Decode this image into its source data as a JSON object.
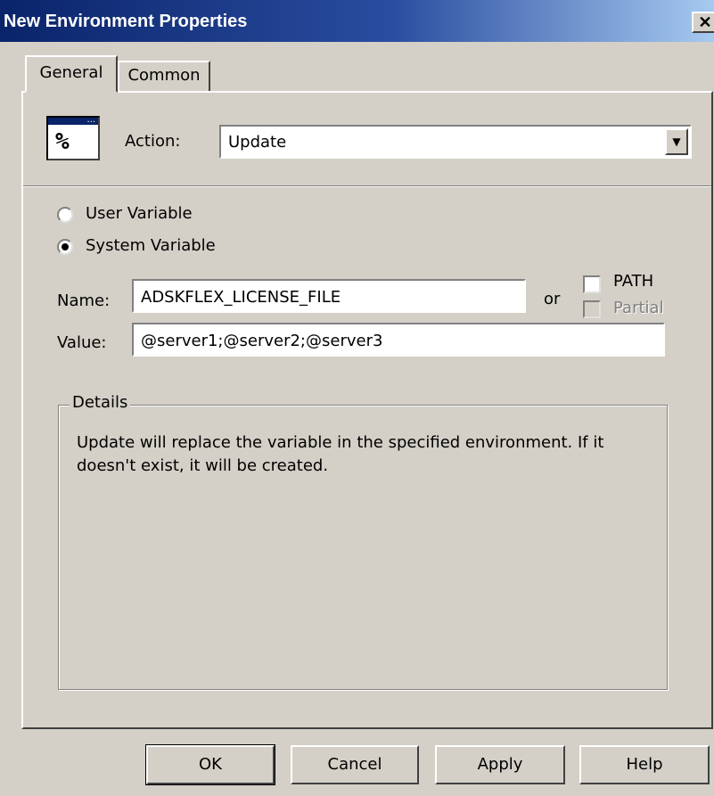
{
  "window": {
    "title": "New Environment Properties",
    "close_glyph": "✕"
  },
  "tabs": [
    {
      "label": "General",
      "active": true
    },
    {
      "label": "Common",
      "active": false
    }
  ],
  "action": {
    "icon": "percent-variable-icon",
    "glyph": "%",
    "label": "Action:",
    "value": "Update"
  },
  "scope": {
    "options": [
      {
        "label": "User Variable",
        "selected": false
      },
      {
        "label": "System Variable",
        "selected": true
      }
    ]
  },
  "name": {
    "label": "Name:",
    "value": "ADSKFLEX_LICENSE_FILE",
    "or_label": "or"
  },
  "path_options": [
    {
      "label": "PATH",
      "checked": false,
      "enabled": true
    },
    {
      "label": "Partial",
      "checked": false,
      "enabled": false
    }
  ],
  "value": {
    "label": "Value:",
    "value": "@server1;@server2;@server3"
  },
  "details": {
    "legend": "Details",
    "text": "Update will replace the variable in the specified environment. If it doesn't exist, it will be created."
  },
  "buttons": {
    "ok": "OK",
    "cancel": "Cancel",
    "apply": "Apply",
    "help": "Help"
  },
  "colors": {
    "title_start": "#0a246a",
    "title_end": "#a6caf0",
    "face": "#d4d0c8"
  }
}
